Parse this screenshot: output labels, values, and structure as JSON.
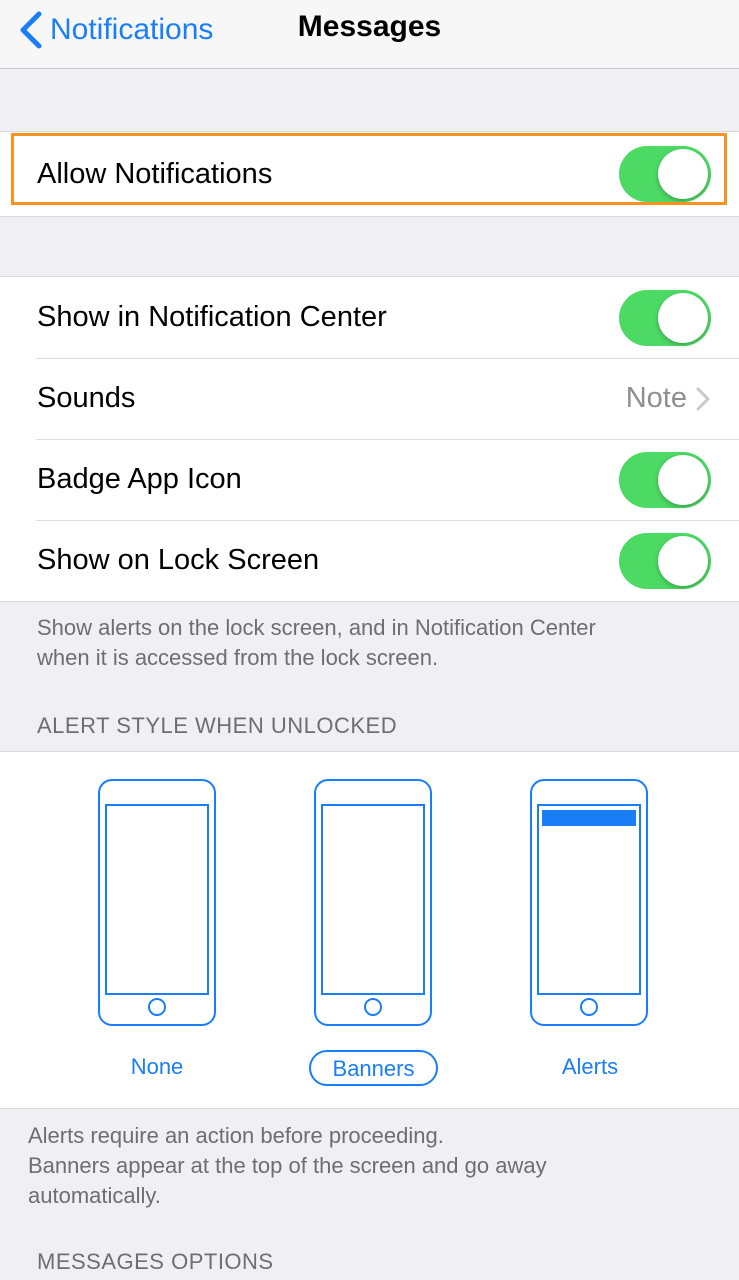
{
  "nav": {
    "back_label": "Notifications",
    "title": "Messages"
  },
  "allow": {
    "label": "Allow Notifications",
    "on": true
  },
  "settings": {
    "show_in_center": {
      "label": "Show in Notification Center",
      "on": true
    },
    "sounds": {
      "label": "Sounds",
      "value": "Note"
    },
    "badge": {
      "label": "Badge App Icon",
      "on": true
    },
    "lock_screen": {
      "label": "Show on Lock Screen",
      "on": true
    }
  },
  "lock_footer": {
    "line1": "Show alerts on the lock screen, and in Notification Center",
    "line2": "when it is accessed from the lock screen."
  },
  "alert_style": {
    "header": "ALERT STYLE WHEN UNLOCKED",
    "options": [
      "None",
      "Banners",
      "Alerts"
    ],
    "selected": "Banners"
  },
  "alert_footer": {
    "line1": "Alerts require an action before proceeding.",
    "line2": "Banners appear at the top of the screen and go away",
    "line3": "automatically."
  },
  "messages_options_header": "MESSAGES OPTIONS",
  "colors": {
    "accent": "#1a7ef8",
    "toggle_on": "#4cd964",
    "highlight": "#f7931e"
  }
}
